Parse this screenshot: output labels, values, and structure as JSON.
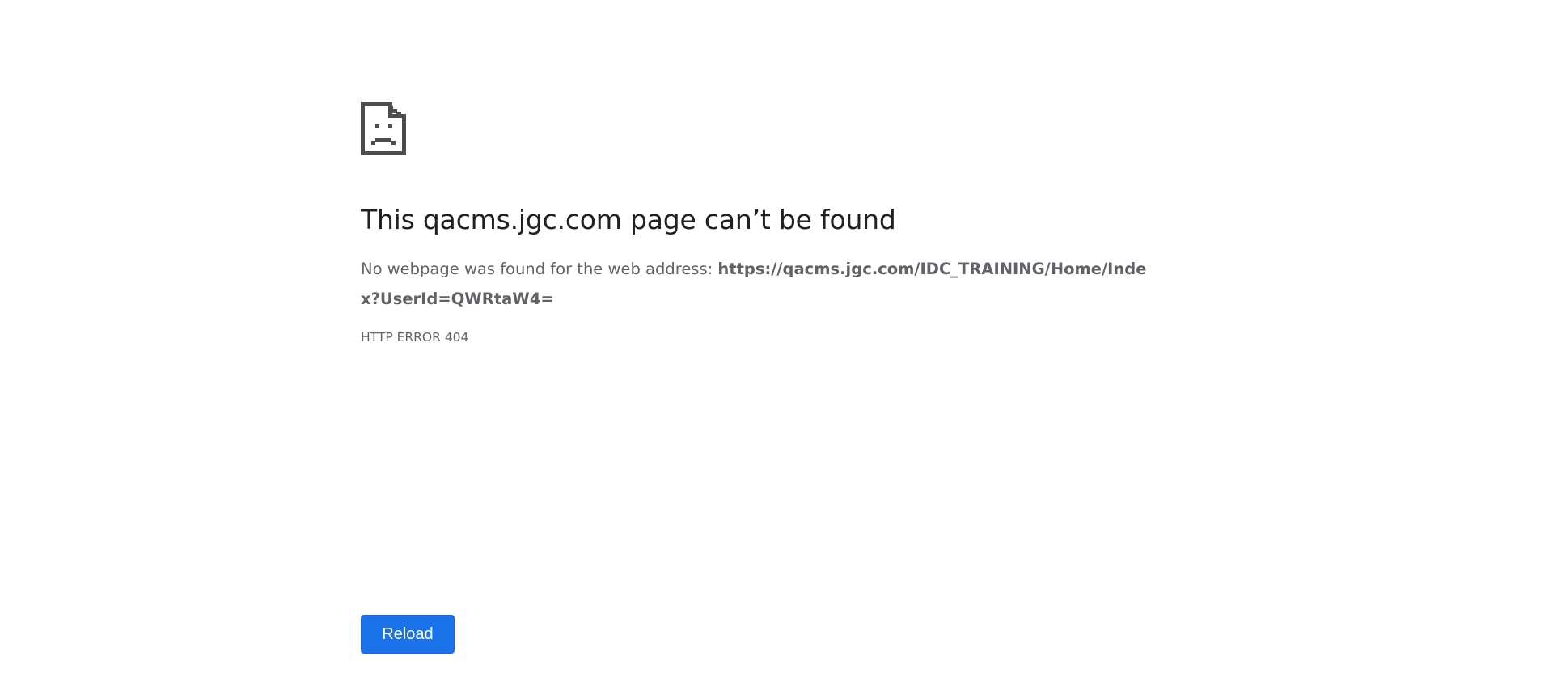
{
  "error": {
    "icon": "sad-page-icon",
    "title": "This qacms.jgc.com page can’t be found",
    "description_prefix": "No webpage was found for the web address: ",
    "url": "https://qacms.jgc.com/IDC_TRAINING/Home/Index?UserId=QWRtaW4=",
    "code": "HTTP ERROR 404"
  },
  "actions": {
    "reload_label": "Reload"
  },
  "colors": {
    "button": "#1a73e8",
    "title_text": "#202124",
    "secondary_text": "#5f6368",
    "icon": "#4d4d4d"
  }
}
